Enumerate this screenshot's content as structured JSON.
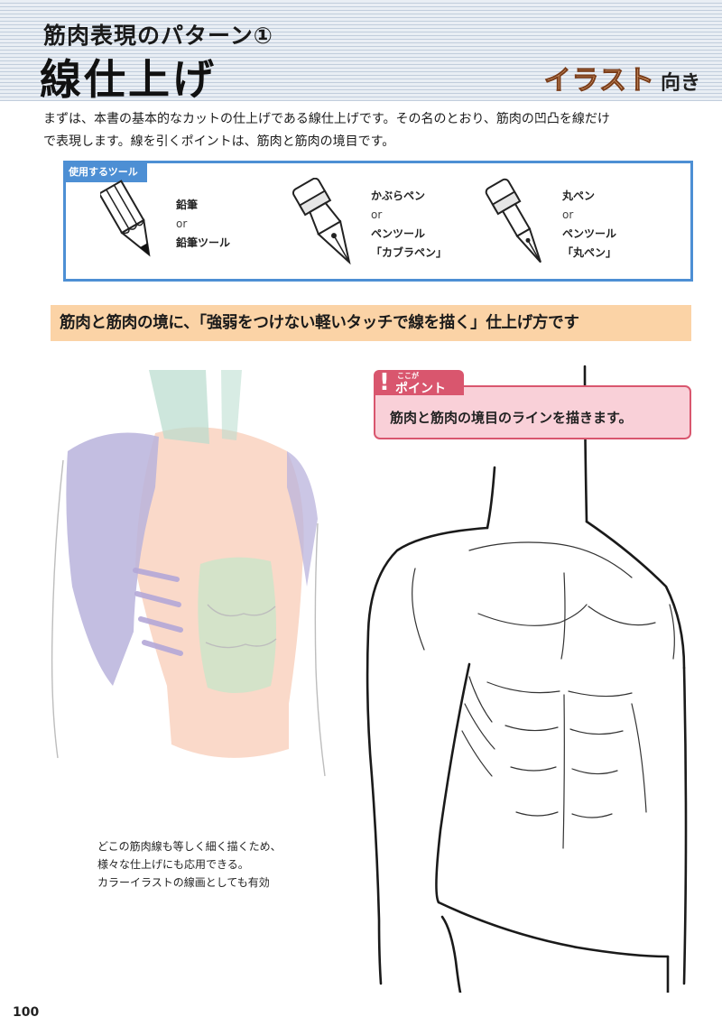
{
  "header": {
    "subtitle": "筋肉表現のパターン①",
    "title": "線仕上げ",
    "tag_main": "イラスト",
    "tag_sub": "向き"
  },
  "intro": {
    "line1": "まずは、本書の基本的なカットの仕上げである線仕上げです。その名のとおり、筋肉の凹凸を線だけ",
    "line2": "で表現します。線を引くポイントは、筋肉と筋肉の境目です。"
  },
  "tools": {
    "label": "使用するツール",
    "items": [
      {
        "icon": "pencil-icon",
        "name": "鉛筆",
        "or": "or",
        "alt": "鉛筆ツール"
      },
      {
        "icon": "kabura-pen-icon",
        "name": "かぶらペン",
        "or": "or",
        "alt": "ペンツール",
        "alt_note": "「カブラペン」"
      },
      {
        "icon": "maru-pen-icon",
        "name": "丸ペン",
        "or": "or",
        "alt": "ペンツール",
        "alt_note": "「丸ペン」"
      }
    ]
  },
  "banner": "筋肉と筋肉の境に、「強弱をつけない軽いタッチで線を描く」仕上げ方です",
  "point": {
    "bang": "!",
    "ruby": "ここが",
    "label": "ポイント",
    "text": "筋肉と筋肉の境目のラインを描きます。"
  },
  "caption": {
    "line1": "どこの筋肉線も等しく細く描くため、",
    "line2": "様々な仕上げにも応用できる。",
    "line3": "カラーイラストの線画としても有効"
  },
  "page_number": "100",
  "colors": {
    "toolbox_border": "#4d8fd4",
    "banner_bg": "#fbd3a6",
    "point_border": "#d9566e",
    "point_bg": "#f9d0d8",
    "deltoid_purple": "#b9b3dc",
    "chest_peach": "#f9d2bf",
    "abs_green": "#cfe3c9"
  }
}
